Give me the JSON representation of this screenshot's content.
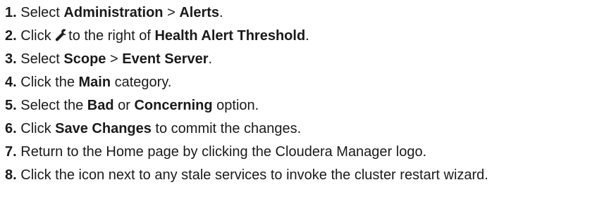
{
  "steps": [
    {
      "number": "1.",
      "parts": [
        {
          "t": "Select "
        },
        {
          "t": "Administration",
          "b": true
        },
        {
          "t": " > "
        },
        {
          "t": "Alerts",
          "b": true
        },
        {
          "t": "."
        }
      ]
    },
    {
      "number": "2.",
      "parts": [
        {
          "t": "Click "
        },
        {
          "icon": "wrench-icon"
        },
        {
          "t": "to the right of "
        },
        {
          "t": "Health Alert Threshold",
          "b": true
        },
        {
          "t": "."
        }
      ]
    },
    {
      "number": "3.",
      "parts": [
        {
          "t": "Select "
        },
        {
          "t": "Scope",
          "b": true
        },
        {
          "t": " > "
        },
        {
          "t": "Event Server",
          "b": true
        },
        {
          "t": "."
        }
      ]
    },
    {
      "number": "4.",
      "parts": [
        {
          "t": "Click the "
        },
        {
          "t": "Main",
          "b": true
        },
        {
          "t": " category."
        }
      ]
    },
    {
      "number": "5.",
      "parts": [
        {
          "t": "Select the "
        },
        {
          "t": "Bad",
          "b": true
        },
        {
          "t": " or "
        },
        {
          "t": "Concerning",
          "b": true
        },
        {
          "t": " option."
        }
      ]
    },
    {
      "number": "6.",
      "parts": [
        {
          "t": "Click "
        },
        {
          "t": "Save Changes",
          "b": true
        },
        {
          "t": " to commit the changes."
        }
      ]
    },
    {
      "number": "7.",
      "parts": [
        {
          "t": "Return to the Home page by clicking the Cloudera Manager logo."
        }
      ]
    },
    {
      "number": "8.",
      "parts": [
        {
          "t": "Click the icon next to any stale services to invoke the cluster restart wizard."
        }
      ]
    }
  ]
}
